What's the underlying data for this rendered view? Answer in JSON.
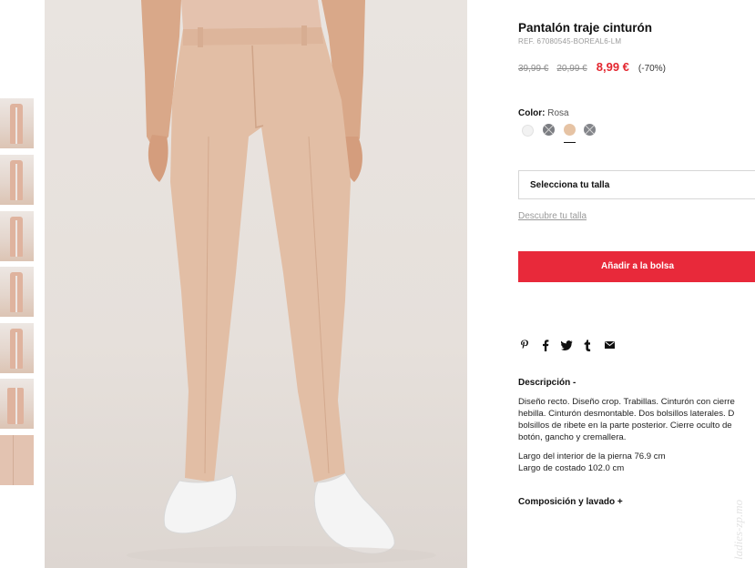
{
  "product": {
    "title": "Pantalón traje cinturón",
    "ref": "REF. 67080545-BOREAL6-LM",
    "prices": {
      "original": "39,99 €",
      "previous": "20,99 €",
      "current": "8,99 €",
      "discount": "(-70%)"
    },
    "color": {
      "label": "Color:",
      "value": "Rosa",
      "swatches": [
        {
          "name": "Blanco",
          "hex": "#f2f2f2",
          "available": true
        },
        {
          "name": "Gris",
          "hex": "#7b7d82",
          "available": false
        },
        {
          "name": "Rosa",
          "hex": "#e6c3a4",
          "available": true,
          "selected": true
        },
        {
          "name": "Gris",
          "hex": "#83858a",
          "available": false
        }
      ]
    },
    "size_select": "Selecciona tu talla",
    "size_guide": "Descubre tu talla",
    "add_to_bag": "Añadir a la bolsa",
    "share_icons": [
      "pinterest-icon",
      "facebook-icon",
      "twitter-icon",
      "tumblr-icon",
      "email-icon"
    ],
    "description": {
      "heading": "Descripción -",
      "lines": [
        "Diseño recto. Diseño crop. Trabillas. Cinturón con cierre",
        "hebilla. Cinturón desmontable. Dos bolsillos laterales. D",
        "bolsillos de ribete en la parte posterior. Cierre oculto de",
        "botón, gancho y cremallera."
      ],
      "measures": [
        "Largo del interior de la pierna 76.9 cm",
        "Largo de costado 102.0 cm"
      ]
    },
    "composition": "Composición y lavado +"
  },
  "watermark": "ladies-zp.mo",
  "colors": {
    "accent": "#e8293a",
    "price_sale": "#e3262f",
    "pants": "#e2bea5"
  }
}
